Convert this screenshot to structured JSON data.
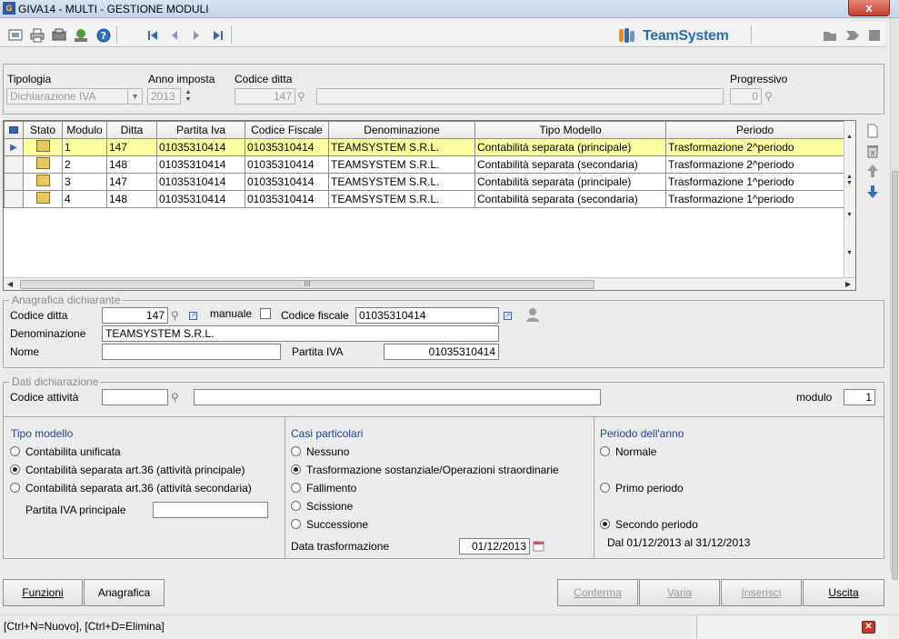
{
  "window": {
    "title": "GIVA14  - MULTI -  GESTIONE MODULI",
    "close_label": "x"
  },
  "toolbar": {
    "icons": [
      "preview-icon",
      "print-icon",
      "print-setup-icon",
      "export-icon",
      "help-icon",
      "first-icon",
      "prev-icon",
      "next-icon",
      "last-icon"
    ],
    "brand": "TeamSystem"
  },
  "header": {
    "tipologia_label": "Tipologia",
    "tipologia_value": "Dichiarazione IVA",
    "anno_label": "Anno imposta",
    "anno_value": "2013",
    "codice_ditta_label": "Codice ditta",
    "codice_ditta_value": "147",
    "progressivo_label": "Progressivo",
    "progressivo_value": "0"
  },
  "grid": {
    "columns": [
      "Stato",
      "Modulo",
      "Ditta",
      "Partita Iva",
      "Codice Fiscale",
      "Denominazione",
      "Tipo Modello",
      "Periodo"
    ],
    "rows": [
      {
        "modulo": "1",
        "ditta": "147",
        "piva": "01035310414",
        "cf": "01035310414",
        "denominazione": "TEAMSYSTEM S.R.L.",
        "tipo": "Contabilità separata (principale)",
        "periodo": "Trasformazione 2^periodo"
      },
      {
        "modulo": "2",
        "ditta": "148",
        "piva": "01035310414",
        "cf": "01035310414",
        "denominazione": "TEAMSYSTEM S.R.L.",
        "tipo": "Contabilità separata (secondaria)",
        "periodo": "Trasformazione 2^periodo"
      },
      {
        "modulo": "3",
        "ditta": "147",
        "piva": "01035310414",
        "cf": "01035310414",
        "denominazione": "TEAMSYSTEM S.R.L.",
        "tipo": "Contabilità separata (principale)",
        "periodo": "Trasformazione 1^periodo"
      },
      {
        "modulo": "4",
        "ditta": "148",
        "piva": "01035310414",
        "cf": "01035310414",
        "denominazione": "TEAMSYSTEM S.R.L.",
        "tipo": "Contabilità separata (secondaria)",
        "periodo": "Trasformazione 1^periodo"
      }
    ],
    "hscroll_grip": "III"
  },
  "anagrafica": {
    "legend": "Anagrafica dichiarante",
    "codice_ditta_label": "Codice ditta",
    "codice_ditta_value": "147",
    "manuale_label": "manuale",
    "codice_fiscale_label": "Codice fiscale",
    "codice_fiscale_value": "01035310414",
    "denominazione_label": "Denominazione",
    "denominazione_value": "TEAMSYSTEM S.R.L.",
    "nome_label": "Nome",
    "nome_value": "",
    "partita_iva_label": "Partita IVA",
    "partita_iva_value": "01035310414"
  },
  "dati": {
    "legend": "Dati dichiarazione",
    "codice_attivita_label": "Codice attività",
    "modulo_label": "modulo",
    "modulo_value": "1",
    "tipo_modello_title": "Tipo modello",
    "tipo_modello_options": [
      "Contabilita unificata",
      "Contabilità separata art.36 (attività principale)",
      "Contabilità separata art.36 (attività secondaria)"
    ],
    "partita_iva_principale_label": "Partita IVA principale",
    "casi_title": "Casi particolari",
    "casi_options": [
      "Nessuno",
      "Trasformazione sostanziale/Operazioni straordinarie",
      "Fallimento",
      "Scissione",
      "Successione"
    ],
    "data_trasformazione_label": "Data trasformazione",
    "data_trasformazione_value": "01/12/2013",
    "periodo_title": "Periodo dell'anno",
    "periodo_options": [
      "Normale",
      "Primo periodo",
      "Secondo periodo"
    ],
    "periodo_range": "Dal 01/12/2013 al 31/12/2013"
  },
  "buttons": {
    "funzioni": "Funzioni",
    "anagrafica": "Anagrafica",
    "conferma": "Conferma",
    "varia": "Varia",
    "inserisci": "Inserisci",
    "uscita": "Uscita"
  },
  "status": {
    "text": "[Ctrl+N=Nuovo], [Ctrl+D=Elimina]"
  },
  "colors": {
    "selected_row": "#ffff9f",
    "brand_blue": "#2a6db5",
    "section_title": "#1d3f9a"
  }
}
